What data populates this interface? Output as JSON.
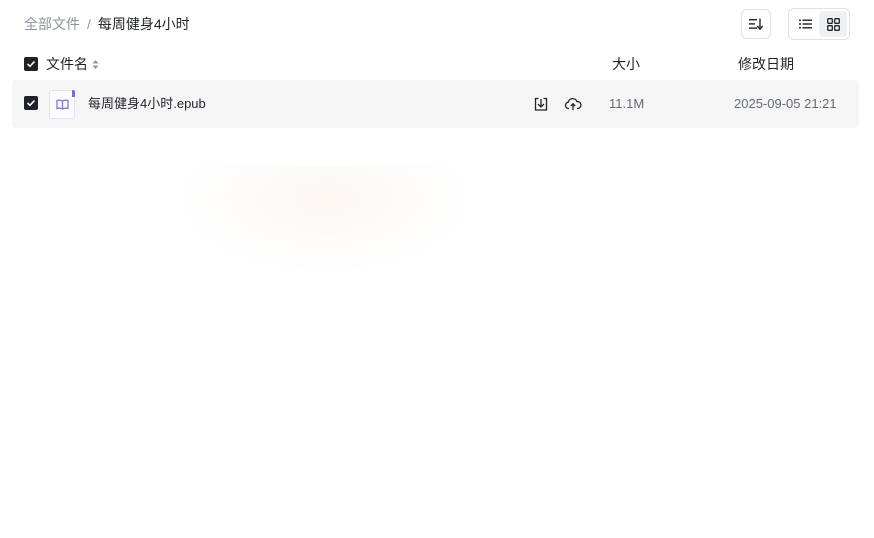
{
  "breadcrumb": {
    "root": "全部文件",
    "separator": "/",
    "current": "每周健身4小时"
  },
  "toolbar": {
    "sort_icon": "sort-descending-icon",
    "view_modes": [
      {
        "name": "list",
        "icon": "list-view-icon",
        "active": true
      },
      {
        "name": "grid",
        "icon": "grid-view-icon",
        "active": false
      }
    ]
  },
  "table": {
    "columns": {
      "name": "文件名",
      "size": "大小",
      "modified": "修改日期"
    },
    "select_all_checked": true,
    "rows": [
      {
        "checked": true,
        "icon": "ebook-icon",
        "name": "每周健身4小时.epub",
        "size": "11.1M",
        "modified": "2025-09-05 21:21"
      }
    ]
  },
  "colors": {
    "text_primary": "#1f2329",
    "text_secondary": "#8f959e",
    "row_bg": "#f5f5f6",
    "checkbox": "#1f2329",
    "ebook_accent": "#7b6cd9"
  }
}
